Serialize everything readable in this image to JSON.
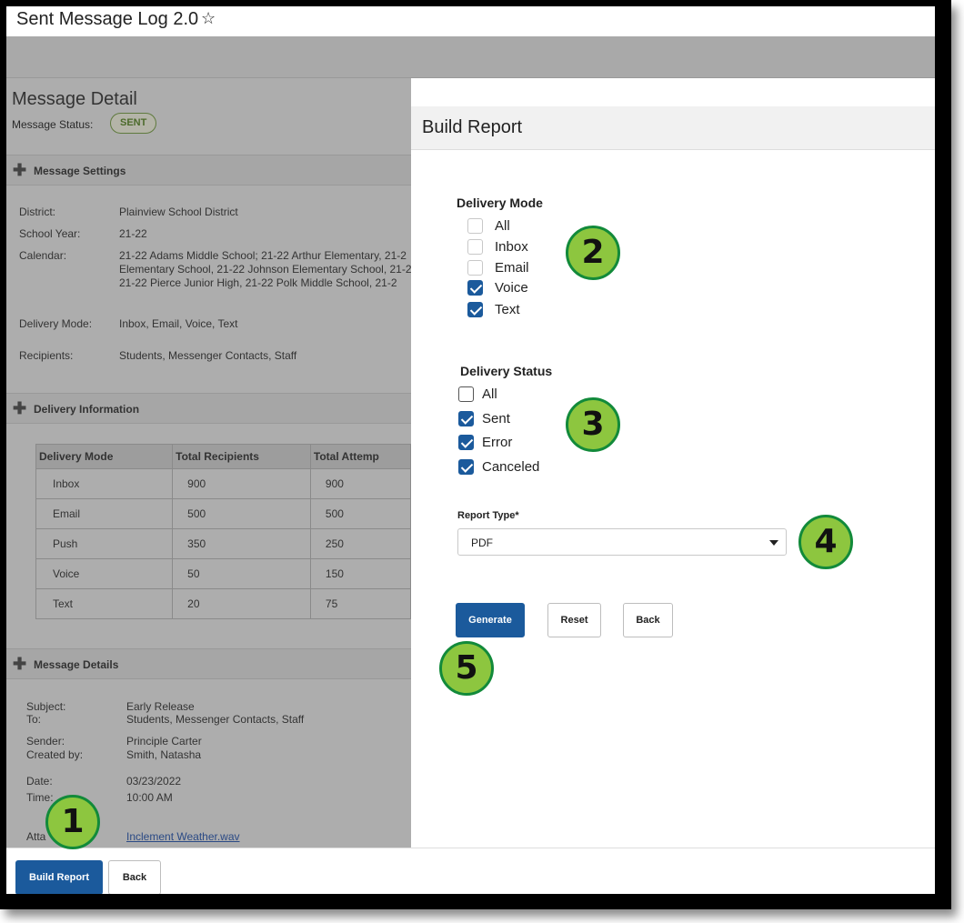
{
  "page": {
    "title": "Sent Message Log 2.0"
  },
  "message_detail": {
    "title": "Message Detail",
    "status_label": "Message Status:",
    "status_value": "SENT"
  },
  "message_settings": {
    "header": "Message Settings",
    "district_label": "District:",
    "district_value": "Plainview School District",
    "school_year_label": "School Year:",
    "school_year_value": "21-22",
    "calendar_label": "Calendar:",
    "calendar_line1": "21-22 Adams Middle School; 21-22 Arthur Elementary, 21-2",
    "calendar_line2": "Elementary School, 21-22 Johnson Elementary School, 21-2",
    "calendar_line3": "21-22 Pierce Junior High,     21-22 Polk Middle School, 21-2",
    "delivery_mode_label": "Delivery Mode:",
    "delivery_mode_value": "Inbox, Email, Voice, Text",
    "recipients_label": "Recipients:",
    "recipients_value": "Students, Messenger Contacts, Staff"
  },
  "delivery_information": {
    "header": "Delivery Information",
    "columns": [
      "Delivery Mode",
      "Total Recipients",
      "Total Attemp"
    ],
    "rows": [
      [
        "Inbox",
        "900",
        "900"
      ],
      [
        "Email",
        "500",
        "500"
      ],
      [
        "Push",
        "350",
        "250"
      ],
      [
        "Voice",
        "50",
        "150"
      ],
      [
        "Text",
        "20",
        "75"
      ]
    ]
  },
  "message_details": {
    "header": "Message Details",
    "subject_label": "Subject:",
    "subject_value": "Early Release",
    "to_label": "To:",
    "to_value": "Students, Messenger Contacts, Staff",
    "sender_label": "Sender:",
    "sender_value": "Principle Carter",
    "created_by_label": "Created by:",
    "created_by_value": "Smith, Natasha",
    "date_label": "Date:",
    "date_value": "03/23/2022",
    "time_label": "Time:",
    "time_value": "10:00 AM",
    "attachment_label_partial": "Atta",
    "attachment_value": "Inclement Weather.wav"
  },
  "build_report": {
    "title": "Build Report",
    "delivery_mode": {
      "title": "Delivery Mode",
      "options": [
        {
          "label": "All",
          "checked": false
        },
        {
          "label": "Inbox",
          "checked": false
        },
        {
          "label": "Email",
          "checked": false
        },
        {
          "label": "Voice",
          "checked": true
        },
        {
          "label": "Text",
          "checked": true
        }
      ]
    },
    "delivery_status": {
      "title": "Delivery Status",
      "options": [
        {
          "label": "All",
          "checked": false
        },
        {
          "label": "Sent",
          "checked": true
        },
        {
          "label": "Error",
          "checked": true
        },
        {
          "label": "Canceled",
          "checked": true
        }
      ]
    },
    "report_type_label": "Report Type*",
    "report_type_value": "PDF",
    "generate_label": "Generate",
    "reset_label": "Reset",
    "back_label": "Back"
  },
  "footer": {
    "build_report_label": "Build Report",
    "back_label": "Back"
  },
  "callouts": [
    "1",
    "2",
    "3",
    "4",
    "5"
  ],
  "colors": {
    "primary_button": "#1b5a9c",
    "callout_fill": "#8dc63f",
    "callout_border": "#128a3a",
    "overlay_gray": "#adadad"
  },
  "icons": [
    "star-icon",
    "plus-icon",
    "chevron-down-icon",
    "checkbox-checked-icon"
  ]
}
